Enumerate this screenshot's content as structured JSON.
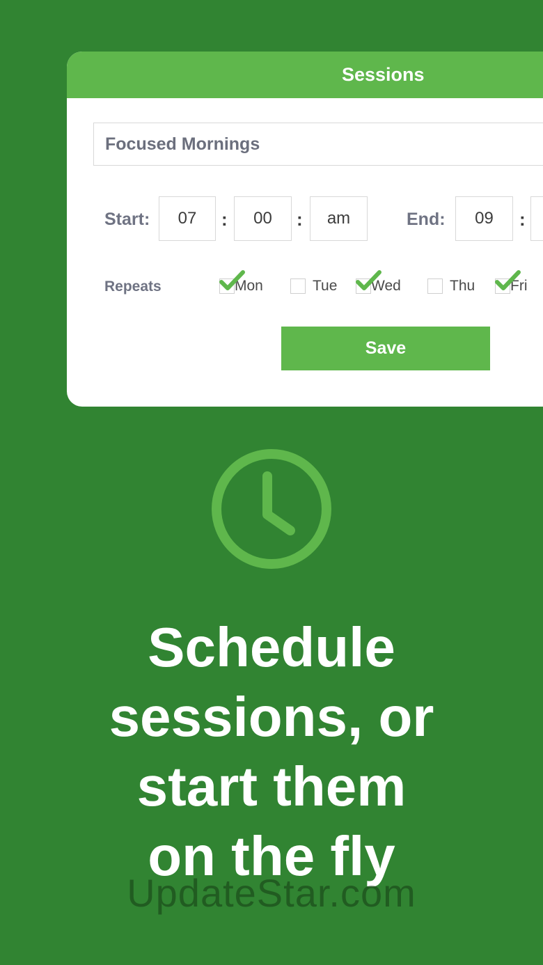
{
  "card": {
    "title": "Sessions",
    "session_name": "Focused Mornings",
    "start_label": "Start:",
    "end_label": "End:",
    "start": {
      "hour": "07",
      "minute": "00",
      "ampm": "am"
    },
    "end": {
      "hour": "09"
    },
    "time_separator": ":",
    "repeats_label": "Repeats",
    "days": [
      {
        "label": "Mon",
        "checked": true
      },
      {
        "label": "Tue",
        "checked": false
      },
      {
        "label": "Wed",
        "checked": true
      },
      {
        "label": "Thu",
        "checked": false
      },
      {
        "label": "Fri",
        "checked": true
      }
    ],
    "save_label": "Save"
  },
  "headline": {
    "line1": "Schedule",
    "line2": "sessions, or",
    "line3": "start them",
    "line4": "on the fly"
  },
  "watermark": "UpdateStar.com",
  "icons": {
    "clock": "clock-icon",
    "check": "checkmark-icon"
  },
  "colors": {
    "background": "#318432",
    "accent": "#5fb74c",
    "card": "#ffffff",
    "label": "#6f7383"
  }
}
